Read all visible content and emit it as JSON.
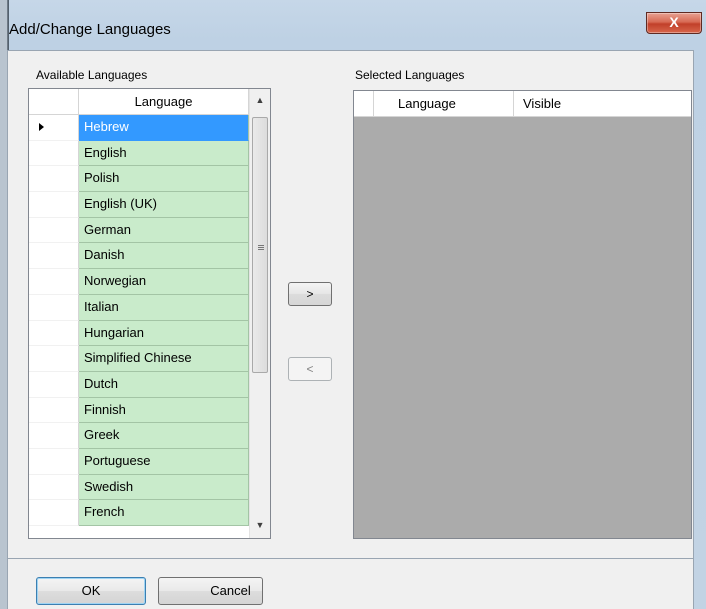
{
  "window": {
    "title": "Add/Change Languages",
    "close_glyph": "X"
  },
  "available": {
    "group_label": "Available Languages",
    "column_header": "Language",
    "selected_row_index": 0,
    "items": [
      "Hebrew",
      "English",
      "Polish",
      "English (UK)",
      "German",
      "Danish",
      "Norwegian",
      "Italian",
      "Hungarian",
      "Simplified Chinese",
      "Dutch",
      "Finnish",
      "Greek",
      "Portuguese",
      "Swedish",
      "French"
    ]
  },
  "move_buttons": {
    "add_label": ">",
    "remove_label": "<"
  },
  "selected": {
    "group_label": "Selected Languages",
    "column_language": "Language",
    "column_visible": "Visible"
  },
  "buttons": {
    "ok": "OK",
    "cancel": "Cancel"
  },
  "colors": {
    "row_background": "#c9ebcb",
    "selected_row": "#3399ff",
    "empty_grid": "#ababab"
  }
}
